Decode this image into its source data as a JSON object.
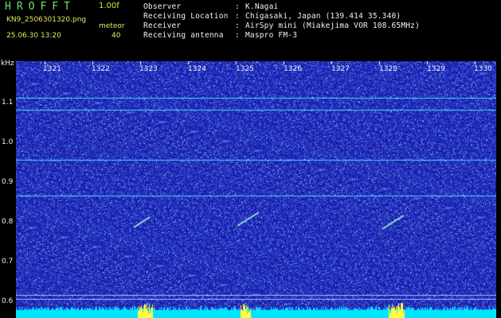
{
  "header": {
    "app_name": "HROFFT",
    "version": "1.00f",
    "filename": "KN9_2506301320.png",
    "mode": "meteor",
    "datetime": "25.06.30 13:20",
    "count": "40"
  },
  "station": [
    {
      "label": "Observer",
      "value": "K.Nagai"
    },
    {
      "label": "Receiving Location",
      "value": "Chigasaki, Japan (139.414 35.340)"
    },
    {
      "label": "Receiver",
      "value": "AirSpy mini (Miakejima VOR 108.65MHz)"
    },
    {
      "label": "Receiving antenna",
      "value": "Maspro FM-3"
    }
  ],
  "spectrogram": {
    "unit": "kHz",
    "x_ticks": [
      "1321",
      "1322",
      "1323",
      "1324",
      "1325",
      "1326",
      "1327",
      "1328",
      "1329",
      "1330"
    ],
    "y_ticks": [
      "1.1",
      "1.0",
      "0.9",
      "0.8",
      "0.7",
      "0.6"
    ],
    "colors": {
      "background": "#1a1aa8",
      "noise": "#4f6fe0",
      "line": "#49d7ff",
      "signal": "#9bf2c8",
      "peak": "#ffff40"
    }
  }
}
